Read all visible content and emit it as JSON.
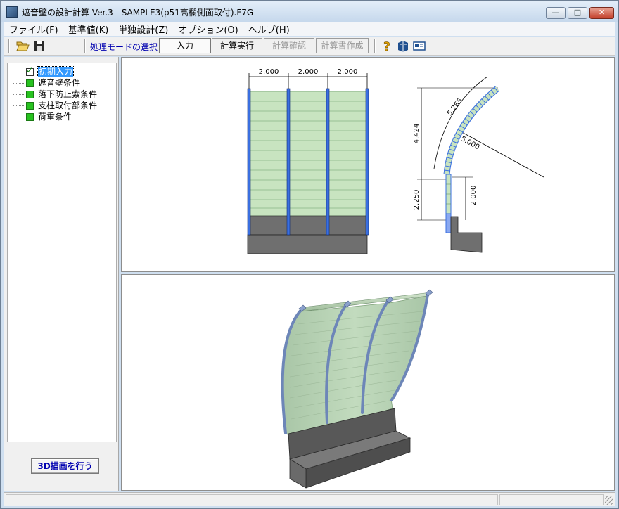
{
  "window": {
    "title": "遮音壁の設計計算 Ver.3 - SAMPLE3(p51高欄側面取付).F7G",
    "minimize_glyph": "—",
    "maximize_glyph": "□",
    "close_glyph": "✕"
  },
  "menu": [
    {
      "label": "ファイル(F)"
    },
    {
      "label": "基準値(K)"
    },
    {
      "label": "単独設計(Z)"
    },
    {
      "label": "オプション(O)"
    },
    {
      "label": "ヘルプ(H)"
    }
  ],
  "toolbar": {
    "open_icon": "folder-open-icon",
    "save_icon": "save-disk-icon",
    "mode_label": "処理モードの選択",
    "input_button": "入力",
    "calc_button": "計算実行",
    "check_button": "計算確認",
    "report_button": "計算書作成",
    "help_icon": "help-question-icon",
    "book_icon": "manual-book-icon",
    "info_icon": "id-card-icon"
  },
  "tree": {
    "items": [
      {
        "label": "初期入力",
        "checked": true,
        "selected": true
      },
      {
        "label": "遮音壁条件",
        "checked": false,
        "selected": false
      },
      {
        "label": "落下防止索条件",
        "checked": false,
        "selected": false
      },
      {
        "label": "支柱取付部条件",
        "checked": false,
        "selected": false
      },
      {
        "label": "荷重条件",
        "checked": false,
        "selected": false
      }
    ]
  },
  "render3d_button": "3D描画を行う",
  "drawing": {
    "front_spans": [
      "2.000",
      "2.000",
      "2.000"
    ],
    "side_arc_length": "5.265",
    "side_radius": "5.000",
    "side_upper_height": "4.424",
    "side_lower_height": "2.250",
    "side_post_height": "2.000"
  },
  "colors": {
    "panel_green": "#c8e4c0",
    "post_blue": "#3a6fe0",
    "base_gray": "#6f6f6f",
    "accent_text": "#0000b0"
  }
}
